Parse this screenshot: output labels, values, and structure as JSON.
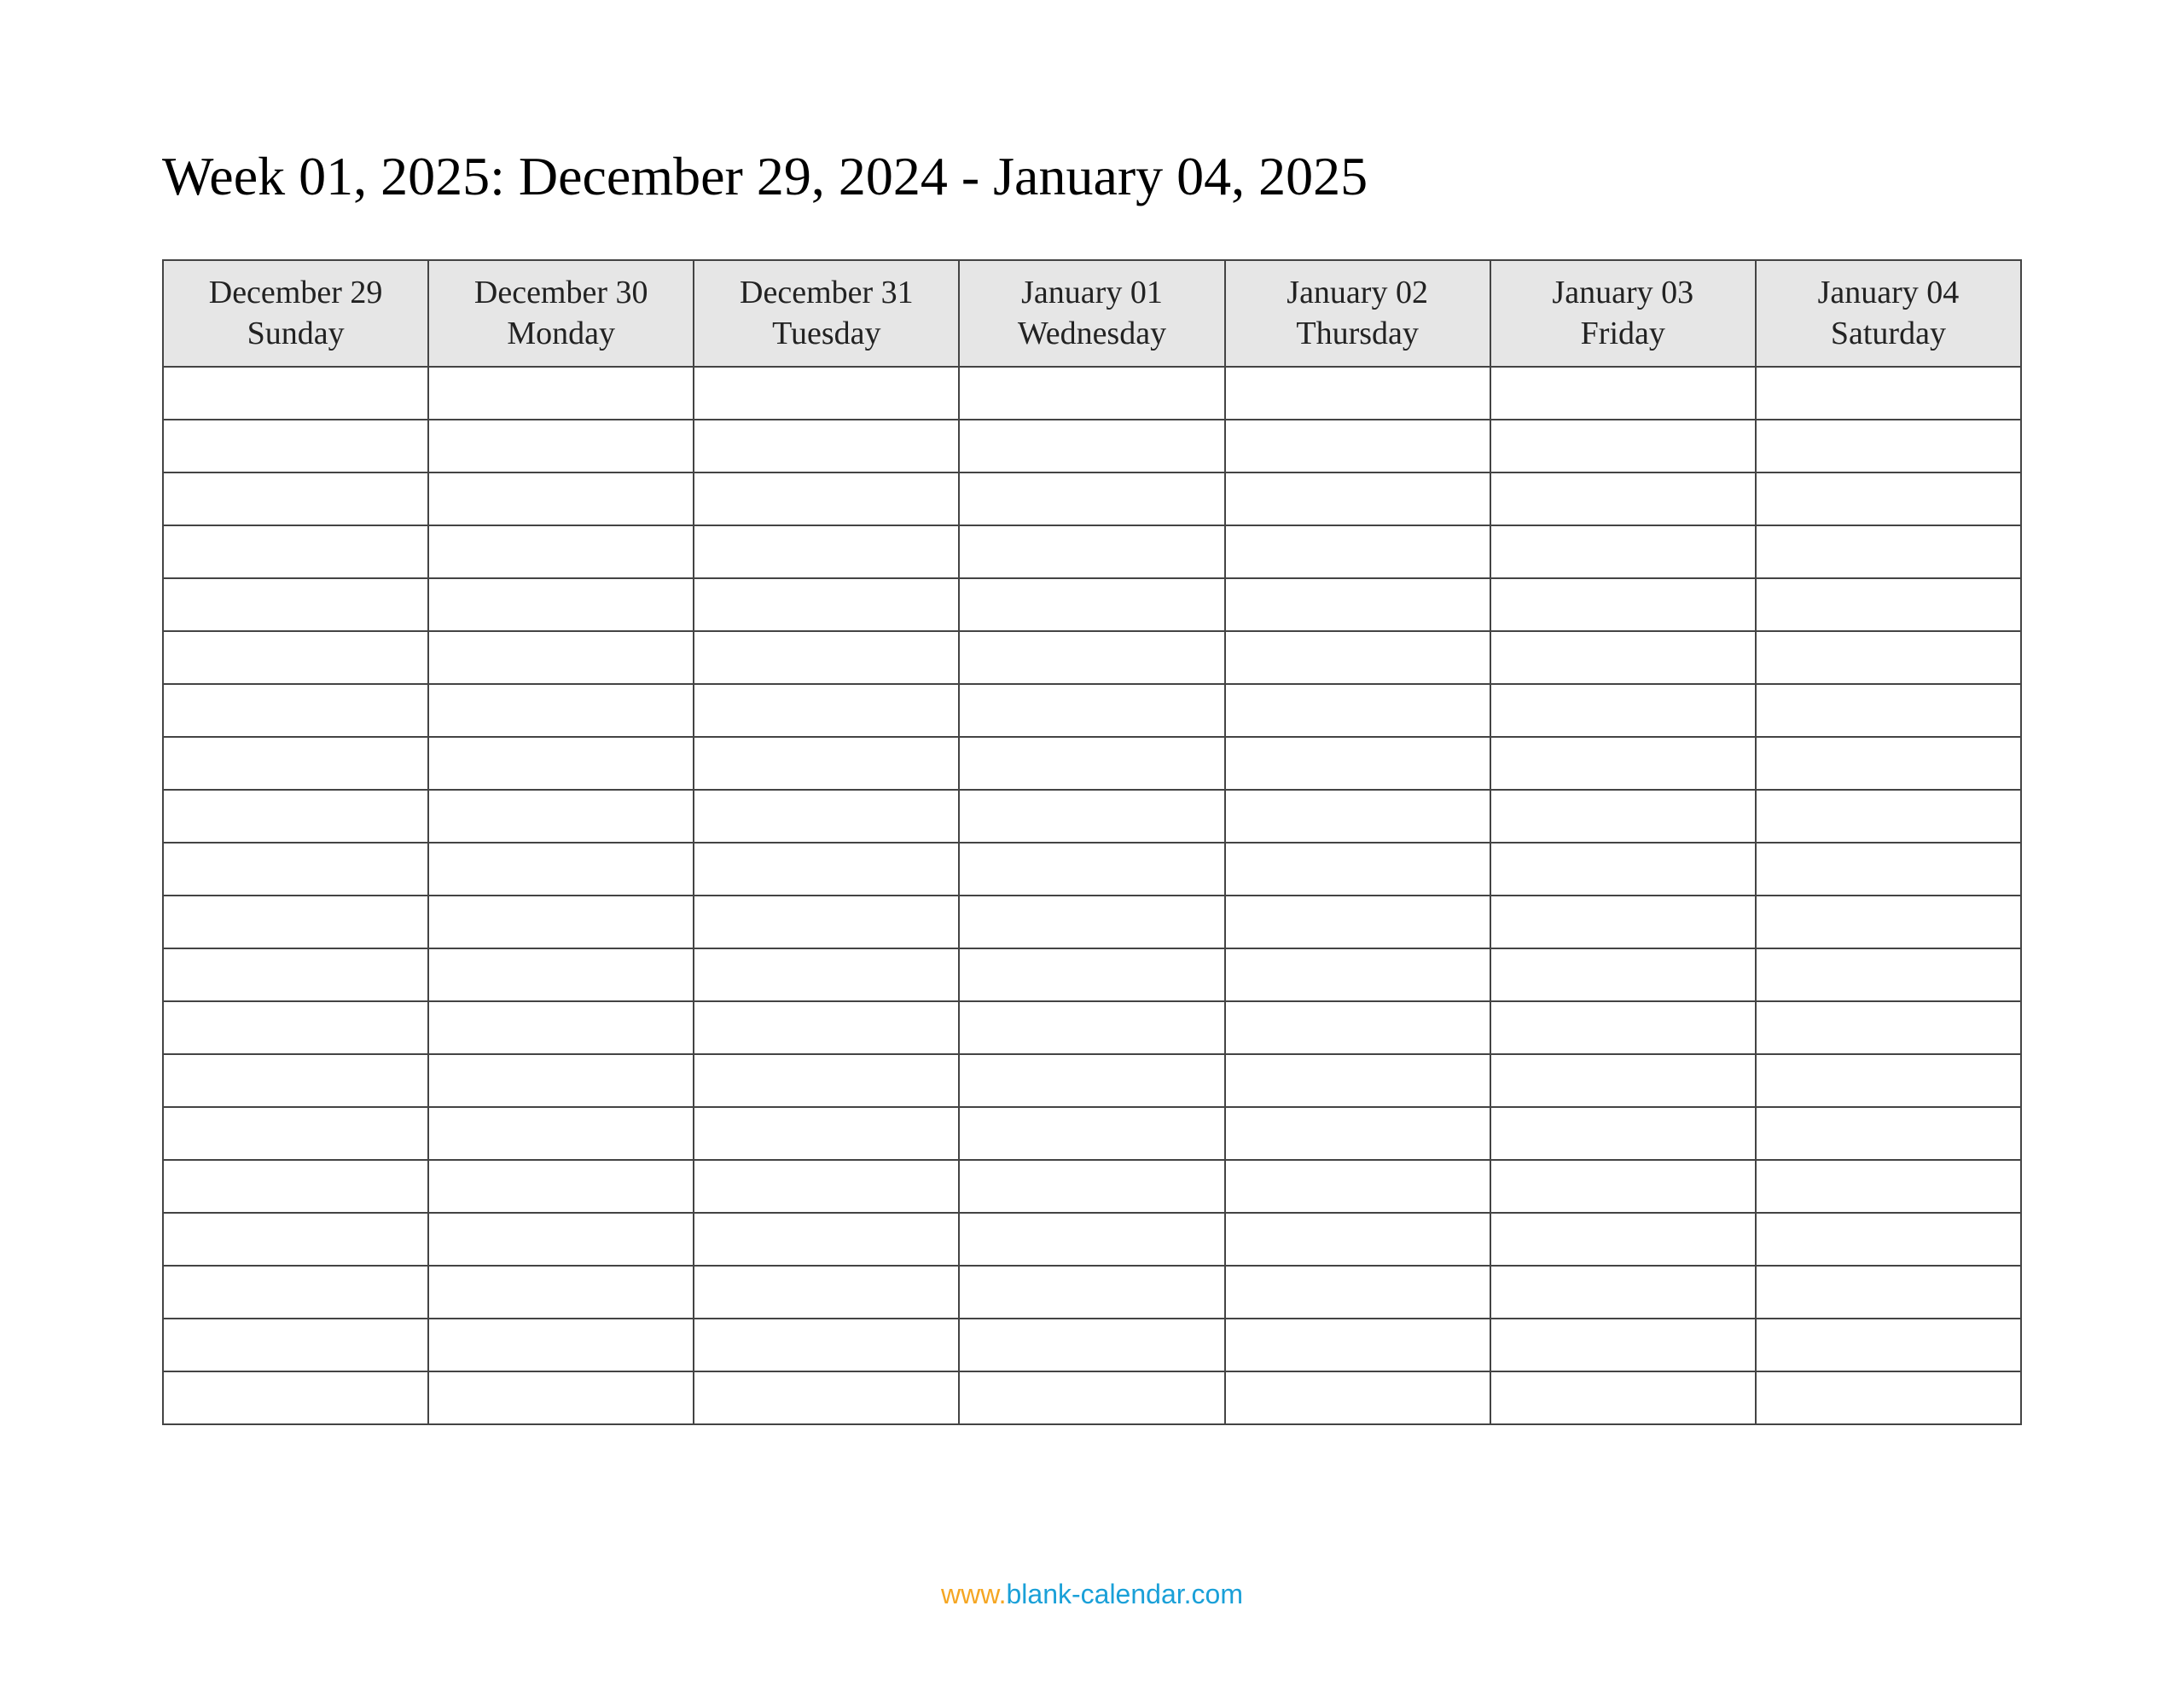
{
  "title": "Week 01, 2025: December 29, 2024 - January 04, 2025",
  "columns": [
    {
      "date": "December 29",
      "day": "Sunday"
    },
    {
      "date": "December 30",
      "day": "Monday"
    },
    {
      "date": "December 31",
      "day": "Tuesday"
    },
    {
      "date": "January 01",
      "day": "Wednesday"
    },
    {
      "date": "January 02",
      "day": "Thursday"
    },
    {
      "date": "January 03",
      "day": "Friday"
    },
    {
      "date": "January 04",
      "day": "Saturday"
    }
  ],
  "row_count": 20,
  "footer": {
    "www": "www.",
    "domain": "blank-calendar.com"
  }
}
